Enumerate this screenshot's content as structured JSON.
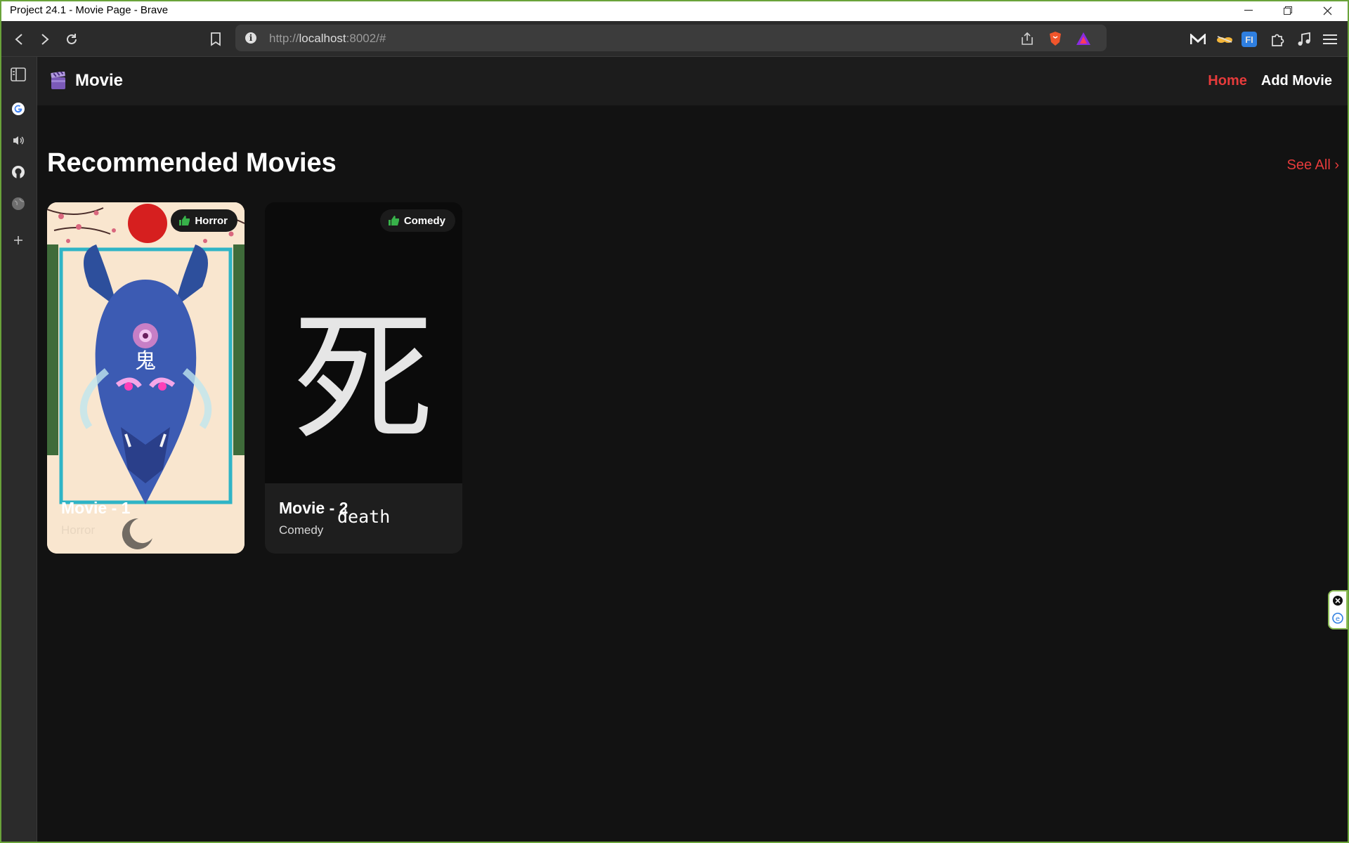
{
  "window": {
    "title": "Project 24.1 - Movie Page - Brave",
    "controls": [
      "minimize",
      "restore",
      "close"
    ]
  },
  "browser": {
    "url_prefix": "http://",
    "url_host": "localhost",
    "url_rest": ":8002/#",
    "nav_icons": [
      "back-icon",
      "forward-icon",
      "reload-icon",
      "bookmark-icon"
    ],
    "extensions": [
      "mega-extension",
      "glasses-extension",
      "fi-extension",
      "puzzle-extension",
      "music-extension",
      "menu-icon"
    ],
    "ext_fi_label": "FI"
  },
  "sidebar": {
    "items": [
      "sidebar-toggle-icon",
      "google-icon",
      "speaker-icon",
      "github-icon",
      "globe-icon",
      "add-icon"
    ]
  },
  "app": {
    "brand": "Movie",
    "nav": {
      "home": "Home",
      "add_movie": "Add Movie"
    },
    "accent": "#e63b3b",
    "section": {
      "title": "Recommended Movies",
      "see_all": "See All ›"
    },
    "movies": [
      {
        "title": "Movie - 1",
        "genre": "Horror",
        "badge": "Horror",
        "poster_glyph": "鬼"
      },
      {
        "title": "Movie - 2",
        "genre": "Comedy",
        "badge": "Comedy",
        "poster_glyph": "死"
      }
    ],
    "overlay_text": "death"
  }
}
